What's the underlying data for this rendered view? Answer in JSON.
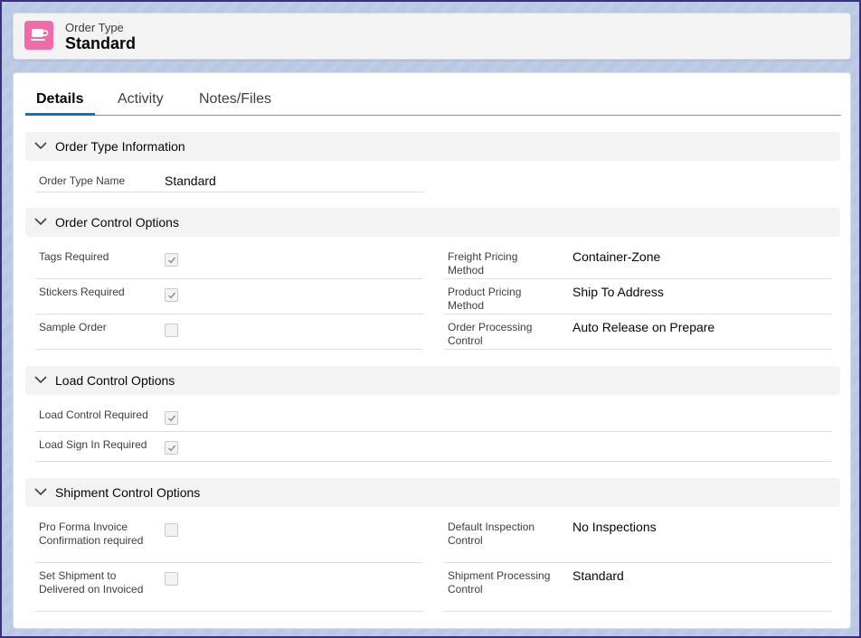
{
  "header": {
    "subtitle": "Order Type",
    "title": "Standard",
    "icon": "cup-icon",
    "icon_color": "#f06ba8"
  },
  "tabs": [
    {
      "label": "Details",
      "active": true
    },
    {
      "label": "Activity",
      "active": false
    },
    {
      "label": "Notes/Files",
      "active": false
    }
  ],
  "sections": {
    "info": {
      "title": "Order Type Information",
      "fields": {
        "name_label": "Order Type Name",
        "name_value": "Standard"
      }
    },
    "order_control": {
      "title": "Order Control Options",
      "left": [
        {
          "label": "Tags Required",
          "checked": true
        },
        {
          "label": "Stickers Required",
          "checked": true
        },
        {
          "label": "Sample Order",
          "checked": false
        }
      ],
      "right": [
        {
          "label": "Freight Pricing Method",
          "value": "Container-Zone"
        },
        {
          "label": "Product Pricing Method",
          "value": "Ship To Address"
        },
        {
          "label": "Order Processing Control",
          "value": "Auto Release on Prepare"
        }
      ]
    },
    "load_control": {
      "title": "Load Control Options",
      "left": [
        {
          "label": "Load Control Required",
          "checked": true
        },
        {
          "label": "Load Sign In Required",
          "checked": true
        }
      ]
    },
    "shipment_control": {
      "title": "Shipment Control Options",
      "left": [
        {
          "label": "Pro Forma Invoice Confirmation required",
          "checked": false
        },
        {
          "label": "Set Shipment to Delivered on Invoiced",
          "checked": false
        }
      ],
      "right": [
        {
          "label": "Default Inspection Control",
          "value": "No Inspections"
        },
        {
          "label": "Shipment Processing Control",
          "value": "Standard"
        }
      ]
    }
  },
  "colors": {
    "accent": "#0176d3",
    "section_bg": "#f3f3f3"
  }
}
